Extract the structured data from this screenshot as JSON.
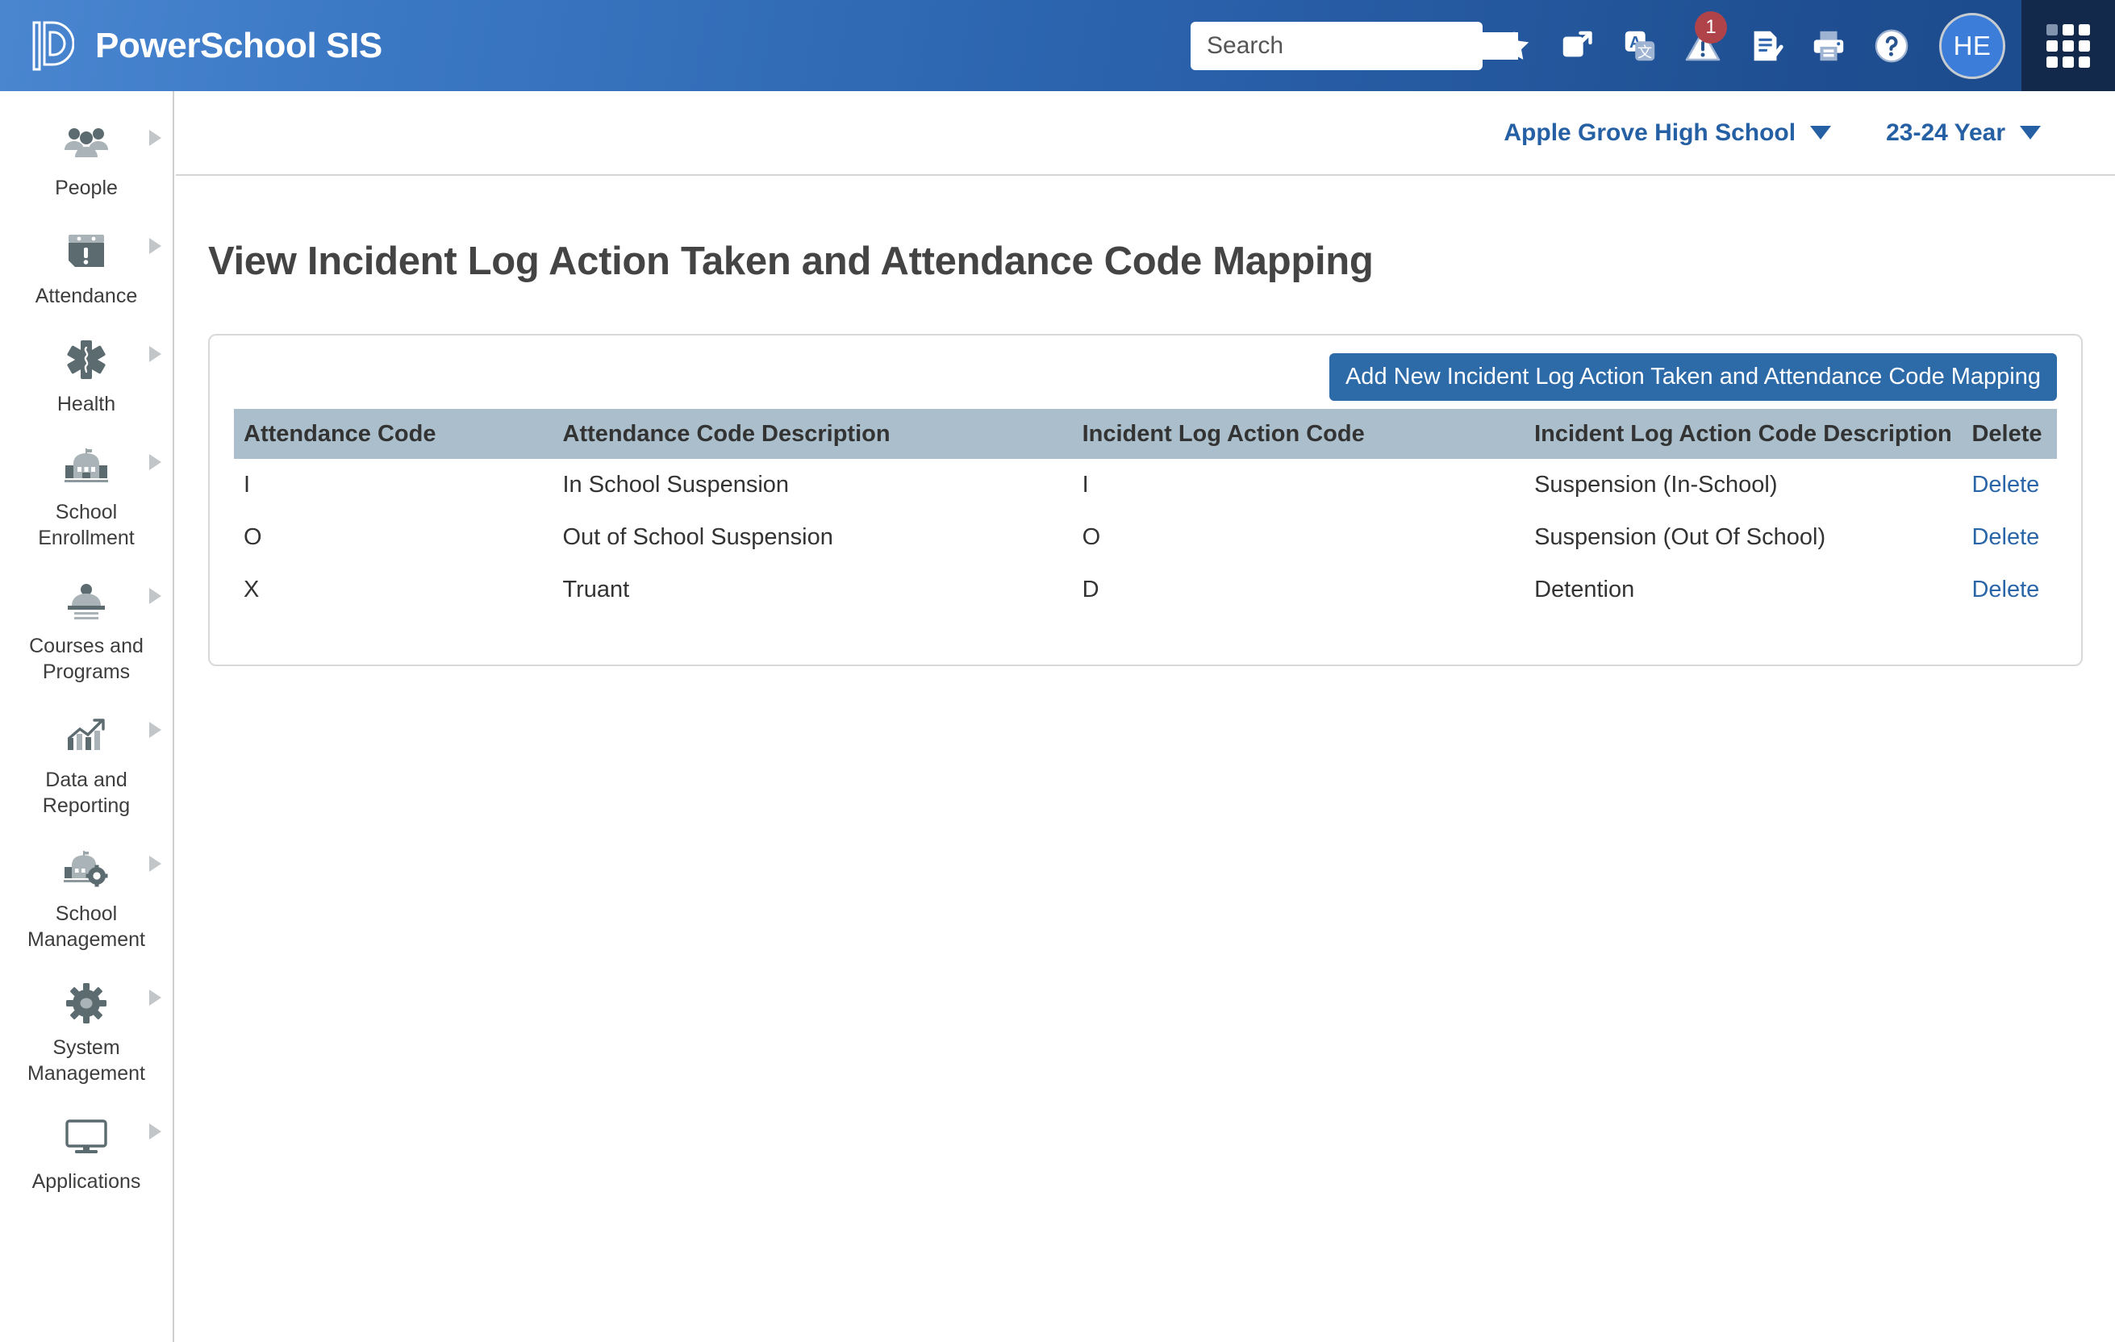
{
  "header": {
    "brand_name": "PowerSchool SIS",
    "logo_icon": "powerschool-p-logo",
    "search": {
      "placeholder": "Search",
      "value": "",
      "icon": "search-icon"
    },
    "icons": [
      {
        "name": "star-icon",
        "label": "Favorites"
      },
      {
        "name": "external-link-icon",
        "label": "Open in new window"
      },
      {
        "name": "translate-icon",
        "label": "Translate"
      },
      {
        "name": "alert-icon",
        "label": "Alerts",
        "badge": "1"
      },
      {
        "name": "report-check-icon",
        "label": "Reports"
      },
      {
        "name": "print-icon",
        "label": "Print"
      },
      {
        "name": "help-icon",
        "label": "Help"
      }
    ],
    "avatar": {
      "initials": "HE",
      "name": "user-avatar"
    },
    "app_grid": {
      "name": "app-grid-icon"
    },
    "colors": {
      "gradient_left": "#4a86d0",
      "gradient_right": "#1b4a8b",
      "app_panel": "#13294b",
      "badge": "#b0434a",
      "avatar": "#3b7dd8"
    }
  },
  "sidebar": {
    "items": [
      {
        "label": "People",
        "icon": "people-icon"
      },
      {
        "label": "Attendance",
        "icon": "attendance-icon"
      },
      {
        "label": "Health",
        "icon": "health-icon"
      },
      {
        "label": "School Enrollment",
        "icon": "school-enrollment-icon"
      },
      {
        "label": "Courses and Programs",
        "icon": "courses-programs-icon"
      },
      {
        "label": "Data and Reporting",
        "icon": "data-reporting-icon"
      },
      {
        "label": "School Management",
        "icon": "school-management-icon"
      },
      {
        "label": "System Management",
        "icon": "system-management-icon"
      },
      {
        "label": "Applications",
        "icon": "applications-icon"
      }
    ]
  },
  "context_bar": {
    "school": "Apple Grove High School",
    "year": "23-24 Year",
    "link_color": "#2660a4"
  },
  "main": {
    "page_title": "View Incident Log Action Taken and Attendance Code Mapping",
    "add_button_label": "Add New Incident Log Action Taken and Attendance Code Mapping",
    "table": {
      "columns": [
        "Attendance Code",
        "Attendance Code Description",
        "Incident Log Action Code",
        "Incident Log Action Code Description",
        "Delete"
      ],
      "header_bg": "#aabfcb",
      "rows": [
        {
          "attendance_code": "I",
          "attendance_code_description": "In School Suspension",
          "incident_log_action_code": "I",
          "incident_log_action_code_description": "Suspension (In-School)",
          "delete_label": "Delete"
        },
        {
          "attendance_code": "O",
          "attendance_code_description": "Out of School Suspension",
          "incident_log_action_code": "O",
          "incident_log_action_code_description": "Suspension (Out Of School)",
          "delete_label": "Delete"
        },
        {
          "attendance_code": "X",
          "attendance_code_description": "Truant",
          "incident_log_action_code": "D",
          "incident_log_action_code_description": "Detention",
          "delete_label": "Delete"
        }
      ]
    }
  }
}
